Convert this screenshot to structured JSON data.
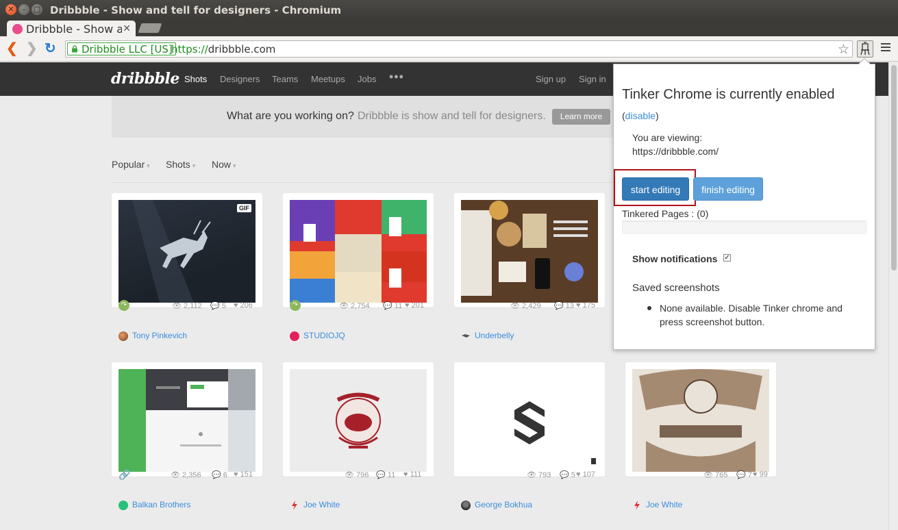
{
  "window": {
    "title": "Dribbble - Show and tell for designers - Chromium",
    "close_glyph": "✕",
    "min_glyph": "–",
    "max_glyph": "□"
  },
  "tab": {
    "title": "Dribbble - Show and tell for designers",
    "close_glyph": "✕"
  },
  "toolbar": {
    "ev_label": "Dribbble LLC [US]",
    "url_scheme": "https://",
    "url_host": "dribbble.com",
    "back_glyph": "❮",
    "forward_glyph": "❯",
    "reload_glyph": "↻",
    "star_glyph": "☆"
  },
  "site": {
    "logo": "dribbble",
    "nav": [
      "Shots",
      "Designers",
      "Teams",
      "Meetups",
      "Jobs"
    ],
    "more": "•••",
    "account": [
      "Sign up",
      "Sign in"
    ]
  },
  "banner": {
    "question": "What are you working on?",
    "tagline": "Dribbble is show and tell for designers.",
    "button": "Learn more"
  },
  "filters": [
    {
      "label": "Popular",
      "chevron": "▾"
    },
    {
      "label": "Shots",
      "chevron": "▾"
    },
    {
      "label": "Now",
      "chevron": "▾"
    }
  ],
  "shots": [
    {
      "views": "2,112",
      "comments": "5",
      "likes": "206",
      "author": "Tony Pinkevich",
      "gif_badge": "GIF",
      "kind": "rebound"
    },
    {
      "views": "2,754",
      "comments": "11",
      "likes": "201",
      "author": "STUDIOJQ",
      "kind": "rebound"
    },
    {
      "views": "2,429",
      "comments": "13",
      "likes": "175",
      "author": "Underbelly",
      "kind": "none"
    },
    {
      "views": "2,356",
      "comments": "6",
      "likes": "151",
      "author": "Balkan Brothers",
      "kind": "attachment"
    },
    {
      "views": "796",
      "comments": "11",
      "likes": "111",
      "author": "Joe White",
      "kind": "none"
    },
    {
      "views": "793",
      "comments": "5",
      "likes": "107",
      "author": "George Bokhua",
      "kind": "none"
    },
    {
      "views": "765",
      "comments": "7",
      "likes": "99",
      "author": "Joe White",
      "kind": "none"
    }
  ],
  "icons": {
    "views": "👁",
    "comments": "💬",
    "likes": "♥",
    "rebound": "↷",
    "attachment": "🔗"
  },
  "popup": {
    "title": "Tinker Chrome is currently enabled",
    "disable_open": "(",
    "disable_link": "disable",
    "disable_close": ")",
    "viewing_label": "You are viewing:",
    "viewing_url": "https://dribbble.com/",
    "start_button": "start editing",
    "finish_button": "finish editing",
    "tinkered": "Tinkered Pages : (0)",
    "notifications_label": "Show notifications",
    "notifications_checked": "✓",
    "saved_heading": "Saved screenshots",
    "saved_none": "None available. Disable Tinker chrome and press screenshot button."
  },
  "colors": {
    "accent": "#3a8dde",
    "button_primary": "#337ab7",
    "highlight": "#b0121a",
    "brand_pink": "#ea4c89"
  }
}
